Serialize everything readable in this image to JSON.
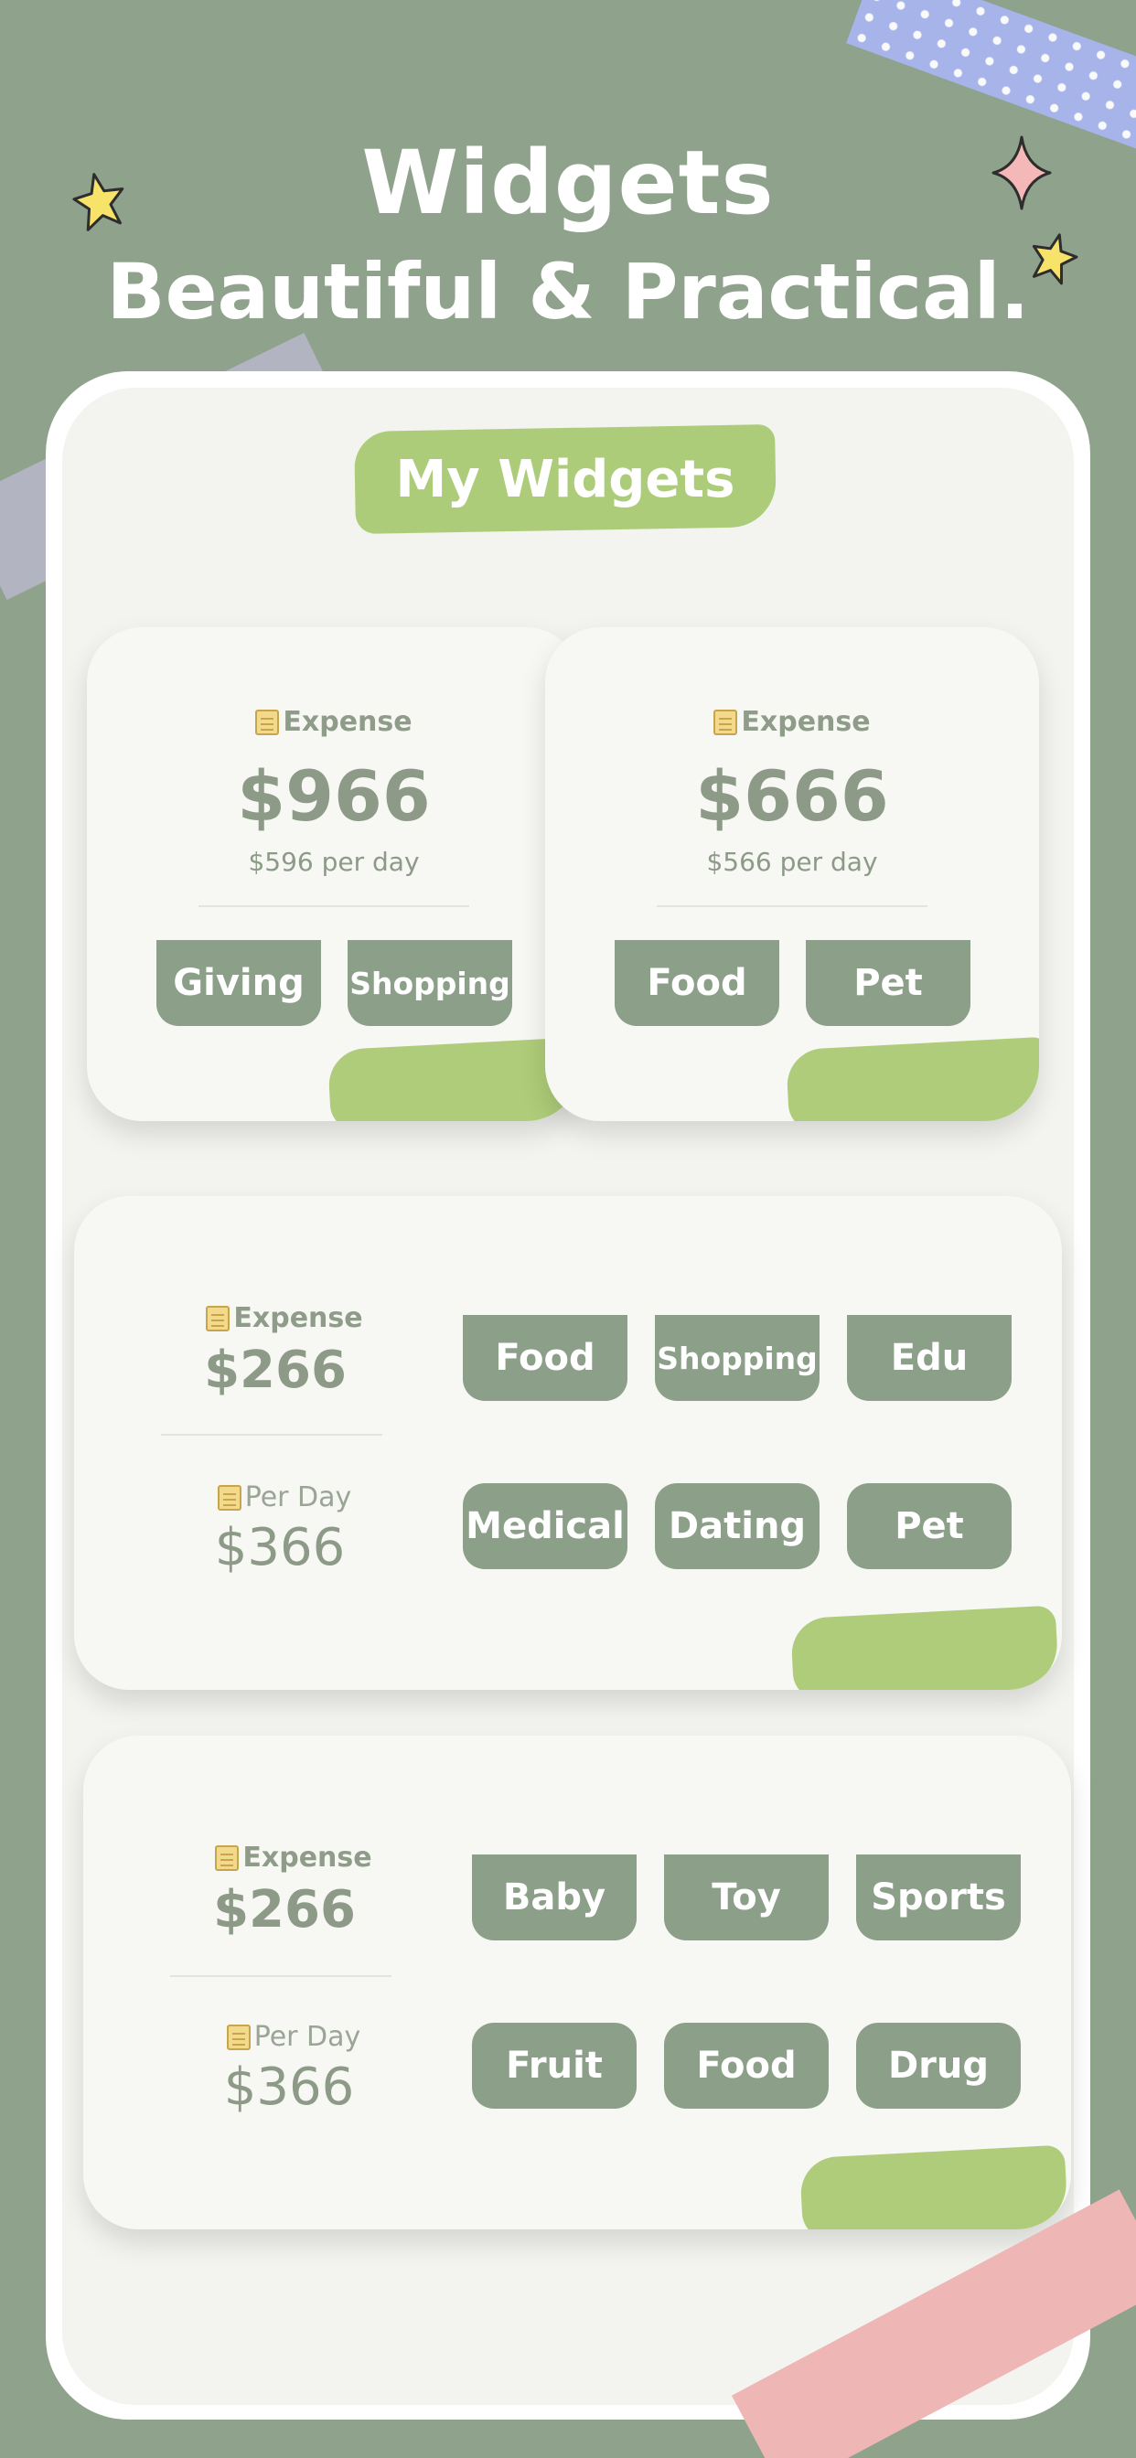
{
  "header": {
    "title": "Widgets",
    "subtitle": "Beautiful & Practical."
  },
  "section_title": "My Widgets",
  "widget_small_1": {
    "label": "Expense",
    "amount": "$966",
    "per_day": "$596 per day",
    "chips": [
      "Giving",
      "Shopping"
    ]
  },
  "widget_small_2": {
    "label": "Expense",
    "amount": "$666",
    "per_day": "$566 per day",
    "chips": [
      "Food",
      "Pet"
    ]
  },
  "widget_medium_1": {
    "expense_label": "Expense",
    "expense_amount": "$266",
    "perday_label": "Per Day",
    "perday_amount": "$366",
    "chips": [
      "Food",
      "Shopping",
      "Edu",
      "Medical",
      "Dating",
      "Pet"
    ]
  },
  "widget_medium_2": {
    "expense_label": "Expense",
    "expense_amount": "$266",
    "perday_label": "Per Day",
    "perday_amount": "$366",
    "chips": [
      "Baby",
      "Toy",
      "Sports",
      "Fruit",
      "Food",
      "Drug"
    ]
  },
  "colors": {
    "background": "#8fa28b",
    "accent_green": "#a7c86f",
    "chip": "#8c9f88",
    "card": "#f7f7f3"
  },
  "icons": [
    "star-icon",
    "sparkle-icon",
    "note-icon"
  ]
}
